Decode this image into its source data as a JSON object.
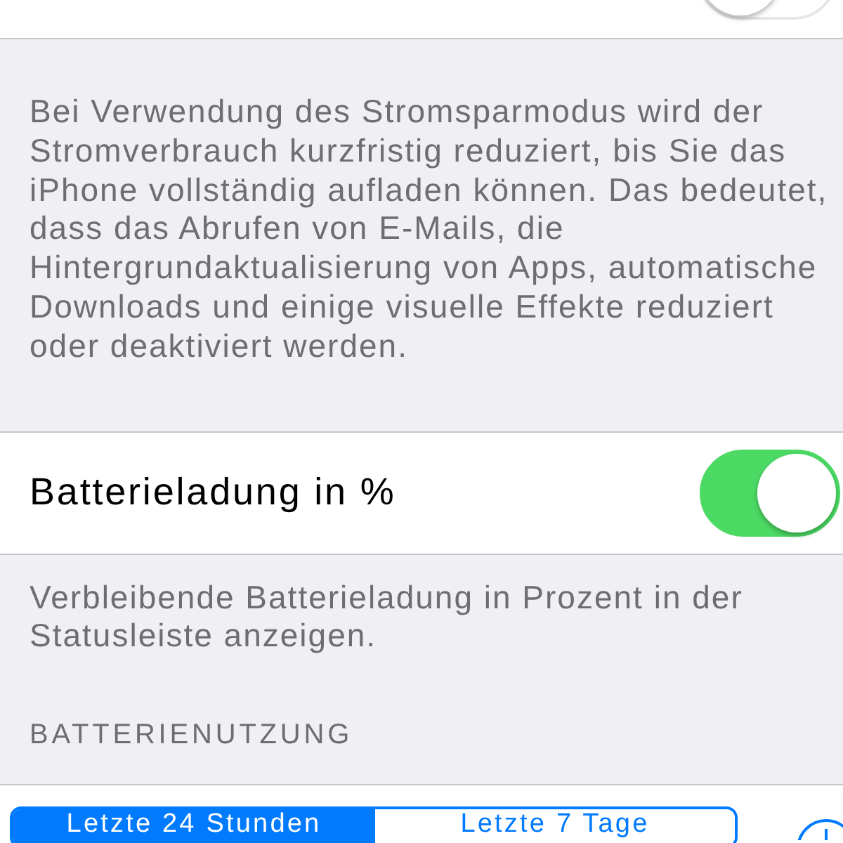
{
  "top_row": {
    "toggle": {
      "on": false
    }
  },
  "power_note": "Bei Verwendung des Stromsparmodus wird der Stromverbrauch kurzfristig reduziert, bis Sie das iPhone vollständig aufladen können. Das bedeutet, dass das Abrufen von E-Mails, die Hintergrundaktualisierung von Apps, automatische Downloads und einige visuelle Effekte reduziert oder deaktiviert werden.",
  "battery_percent_row": {
    "label": "Batterieladung in %",
    "toggle": {
      "on": true
    }
  },
  "battery_percent_note": "Verbleibende Batterieladung in Prozent in der Statusleiste anzeigen.",
  "section_header": "BATTERIENUTZUNG",
  "segments": [
    {
      "label": "Letzte 24 Stunden",
      "selected": true
    },
    {
      "label": "Letzte 7 Tage",
      "selected": false
    }
  ]
}
